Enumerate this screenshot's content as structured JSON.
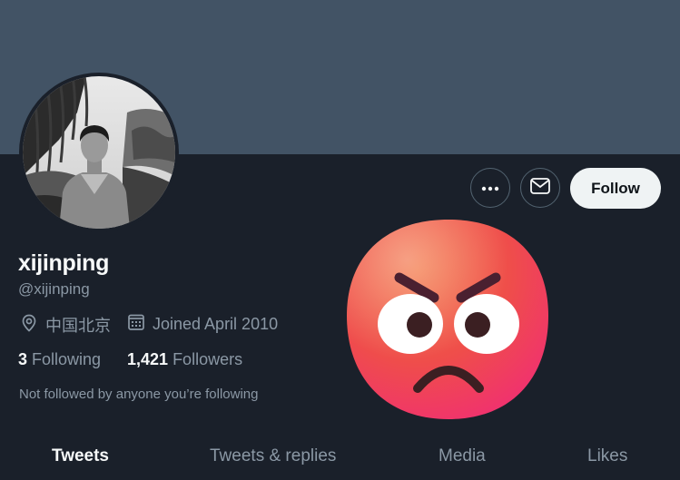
{
  "profile": {
    "display_name": "xijinping",
    "handle": "@xijinping",
    "location": "中国北京",
    "joined": "Joined April 2010",
    "following_count": "3",
    "following_label": "Following",
    "followers_count": "1,421",
    "followers_label": "Followers",
    "not_followed_text": "Not followed by anyone you’re following"
  },
  "actions": {
    "follow_label": "Follow",
    "more_icon": "more-icon",
    "message_icon": "envelope-icon"
  },
  "tabs": [
    {
      "label": "Tweets",
      "active": true
    },
    {
      "label": "Tweets & replies",
      "active": false
    },
    {
      "label": "Media",
      "active": false
    },
    {
      "label": "Likes",
      "active": false
    }
  ],
  "overlay": {
    "emoji": "angry-face-emoji"
  },
  "colors": {
    "banner": "#425365",
    "background": "#1a202a",
    "secondary_text": "#8b98a5",
    "follow_button": "#eff3f4"
  }
}
